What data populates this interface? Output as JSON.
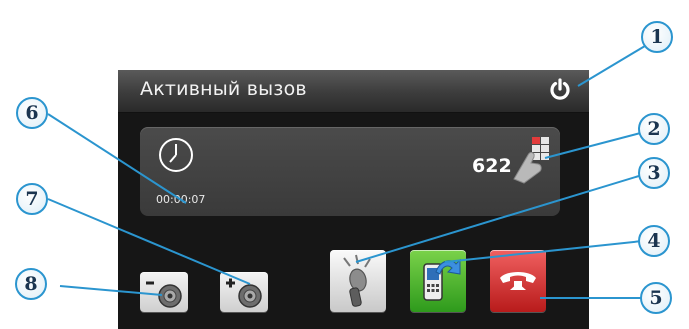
{
  "screen": {
    "title": "Активный вызов",
    "call_timer": "00:00:07",
    "phone_number": "622"
  },
  "callouts": [
    "1",
    "2",
    "3",
    "4",
    "5",
    "6",
    "7",
    "8"
  ],
  "icons": {
    "power": "power-icon",
    "clock": "clock-icon",
    "keypad": "keypad-hand-icon",
    "mic": "microphone-icon",
    "transfer": "phone-transfer-icon",
    "hangup": "hang-up-icon",
    "volume_down": "volume-down-icon",
    "volume_up": "volume-up-icon"
  },
  "colors": {
    "callout_border": "#2b95cf",
    "leader_line": "#2b95cf",
    "transfer_button": "#3aa52a",
    "hangup_button": "#d32b2b"
  }
}
